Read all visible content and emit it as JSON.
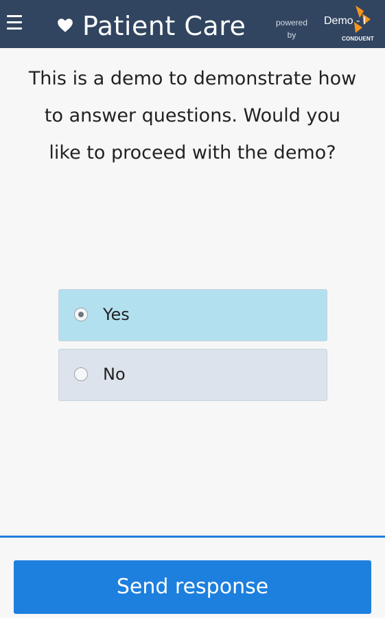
{
  "header": {
    "menu_icon": "hamburger-menu-icon",
    "heart_icon": "heart-icon",
    "title": "Patient Care",
    "powered_by_line1": "powered",
    "powered_by_line2": "by",
    "demo_label": "Demo - I",
    "logo_wordmark": "CONDUENT",
    "background_color": "#314560",
    "logo_color": "#f7941d"
  },
  "question": {
    "text": "This is a demo to demonstrate how to answer questions. Would you like to proceed with the demo?"
  },
  "options": [
    {
      "label": "Yes",
      "selected": true
    },
    {
      "label": "No",
      "selected": false
    }
  ],
  "footer": {
    "send_label": "Send response",
    "accent_color": "#1d7fde"
  }
}
